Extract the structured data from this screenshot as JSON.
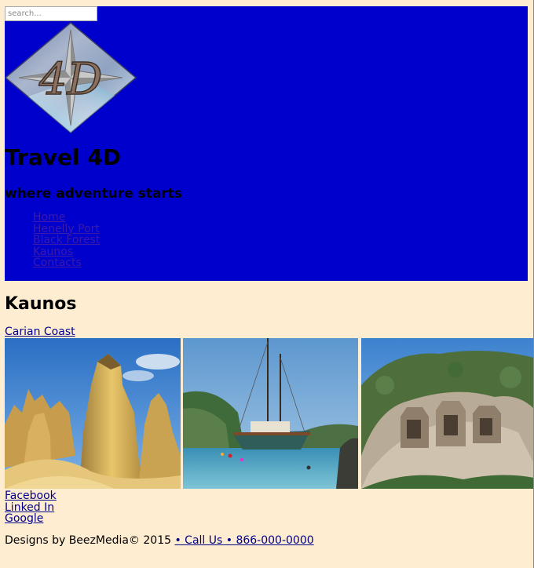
{
  "search": {
    "placeholder": "search..."
  },
  "header": {
    "logo_text": "4D",
    "title": "Travel 4D",
    "tagline": "where adventure starts",
    "bg_color": "#0000cc"
  },
  "nav": {
    "items": [
      {
        "label": "Home"
      },
      {
        "label": "Henelly Port"
      },
      {
        "label": "Black Forest"
      },
      {
        "label": "Kaunos"
      },
      {
        "label": "Contacts"
      }
    ]
  },
  "main": {
    "heading": "Kaunos",
    "sub_link": "Carian Coast",
    "photos": [
      {
        "name": "rock-formations-photo"
      },
      {
        "name": "sailing-boat-photo"
      },
      {
        "name": "rock-tombs-photo"
      }
    ]
  },
  "social": {
    "links": [
      {
        "label": "Facebook"
      },
      {
        "label": "Linked In"
      },
      {
        "label": "Google"
      }
    ]
  },
  "footer": {
    "credit": "Designs by BeezMedia© 2015",
    "call_label": "• Call Us • 866-000-0000"
  },
  "colors": {
    "page_bg": "#ffedd2",
    "link": "#00008b",
    "nav_link": "#3a1aa8"
  }
}
